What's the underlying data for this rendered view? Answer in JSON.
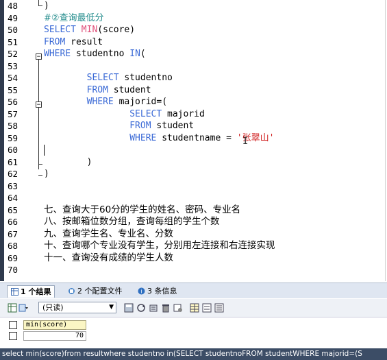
{
  "editor": {
    "lines": [
      {
        "n": "48",
        "segs": [
          {
            "t": ")",
            "c": "plain"
          }
        ]
      },
      {
        "n": "49",
        "segs": [
          {
            "t": "#②查询最低分",
            "c": "cmt"
          }
        ]
      },
      {
        "n": "50",
        "segs": [
          {
            "t": "SELECT ",
            "c": "kw"
          },
          {
            "t": "MIN",
            "c": "fn"
          },
          {
            "t": "(score)",
            "c": "plain"
          }
        ]
      },
      {
        "n": "51",
        "segs": [
          {
            "t": "FROM ",
            "c": "kw"
          },
          {
            "t": "result",
            "c": "plain"
          }
        ]
      },
      {
        "n": "52",
        "segs": [
          {
            "t": "WHERE ",
            "c": "kw"
          },
          {
            "t": "studentno ",
            "c": "plain"
          },
          {
            "t": "IN",
            "c": "kw"
          },
          {
            "t": "(",
            "c": "plain"
          }
        ]
      },
      {
        "n": "53",
        "segs": []
      },
      {
        "n": "54",
        "segs": [
          {
            "t": "        SELECT ",
            "c": "kw"
          },
          {
            "t": "studentno",
            "c": "plain"
          }
        ]
      },
      {
        "n": "55",
        "segs": [
          {
            "t": "        FROM ",
            "c": "kw"
          },
          {
            "t": "student",
            "c": "plain"
          }
        ]
      },
      {
        "n": "56",
        "segs": [
          {
            "t": "        WHERE ",
            "c": "kw"
          },
          {
            "t": "majorid=(",
            "c": "plain"
          }
        ]
      },
      {
        "n": "57",
        "segs": [
          {
            "t": "                SELECT ",
            "c": "kw"
          },
          {
            "t": "majorid",
            "c": "plain"
          }
        ]
      },
      {
        "n": "58",
        "segs": [
          {
            "t": "                FROM ",
            "c": "kw"
          },
          {
            "t": "student",
            "c": "plain"
          }
        ]
      },
      {
        "n": "59",
        "segs": [
          {
            "t": "                WHERE ",
            "c": "kw"
          },
          {
            "t": "studentname = ",
            "c": "plain"
          },
          {
            "t": "'张翠山'",
            "c": "str"
          }
        ]
      },
      {
        "n": "60",
        "segs": []
      },
      {
        "n": "61",
        "segs": [
          {
            "t": "        )",
            "c": "plain"
          }
        ]
      },
      {
        "n": "62",
        "segs": [
          {
            "t": ")",
            "c": "plain"
          }
        ]
      },
      {
        "n": "63",
        "segs": []
      },
      {
        "n": "64",
        "segs": []
      },
      {
        "n": "65",
        "segs": [
          {
            "t": "七、查询大于60分的学生的姓名、密码、专业名",
            "c": "cn"
          }
        ]
      },
      {
        "n": "66",
        "segs": [
          {
            "t": "八、按邮箱位数分组，查询每组的学生个数",
            "c": "cn"
          }
        ]
      },
      {
        "n": "67",
        "segs": [
          {
            "t": "九、查询学生名、专业名、分数",
            "c": "cn"
          }
        ]
      },
      {
        "n": "68",
        "segs": [
          {
            "t": "十、查询哪个专业没有学生，分别用左连接和右连接实现",
            "c": "cn"
          }
        ]
      },
      {
        "n": "69",
        "segs": [
          {
            "t": "十一、查询没有成绩的学生人数",
            "c": "cn"
          }
        ]
      },
      {
        "n": "70",
        "segs": []
      }
    ]
  },
  "tabs": [
    {
      "label": "1 个结果",
      "icon": "result-grid-icon",
      "active": true
    },
    {
      "label": "2 个配置文件",
      "icon": "profile-icon",
      "active": false
    },
    {
      "label": "3 条信息",
      "icon": "info-icon",
      "active": false
    }
  ],
  "toolbar": {
    "mode_value": "(只读)"
  },
  "result": {
    "column": "min(score)",
    "value": "70"
  },
  "status": {
    "text": "select min(score)from resultwhere studentno in(SELECT studentnoFROM studentWHERE majorid=(S"
  }
}
